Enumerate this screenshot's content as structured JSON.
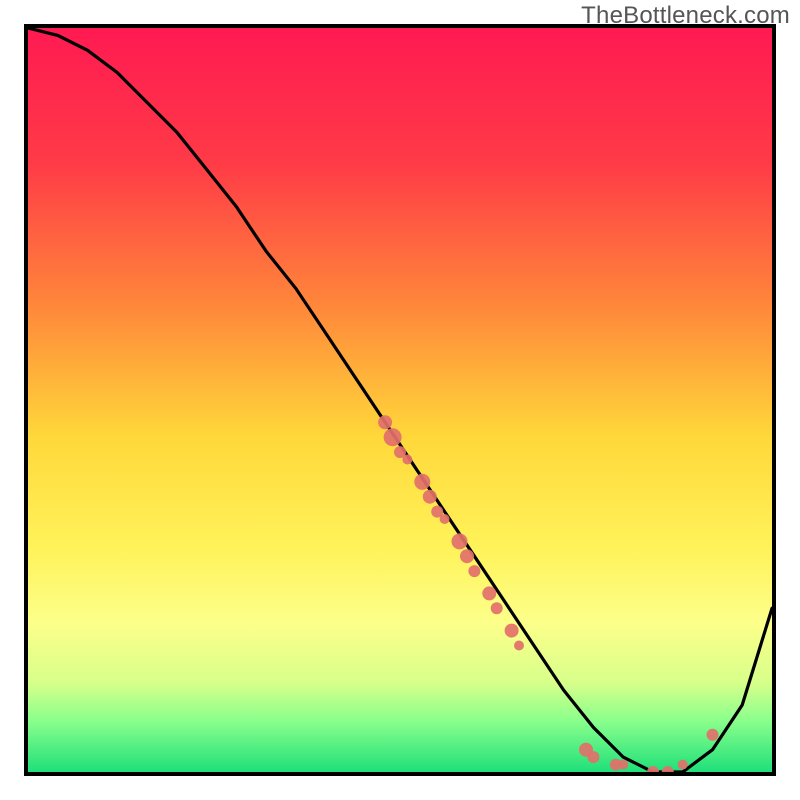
{
  "watermark": "TheBottleneck.com",
  "chart_data": {
    "type": "line",
    "title": "",
    "xlabel": "",
    "ylabel": "",
    "ylim": [
      0,
      100
    ],
    "xlim": [
      0,
      100
    ],
    "background_gradient": {
      "direction": "vertical",
      "stops": [
        {
          "pos": 0,
          "color": "#ff1a52"
        },
        {
          "pos": 18,
          "color": "#ff3a47"
        },
        {
          "pos": 38,
          "color": "#ff8a3a"
        },
        {
          "pos": 55,
          "color": "#ffd83a"
        },
        {
          "pos": 70,
          "color": "#fff35a"
        },
        {
          "pos": 80,
          "color": "#fcff8a"
        },
        {
          "pos": 88,
          "color": "#d7ff8a"
        },
        {
          "pos": 93,
          "color": "#8cff8c"
        },
        {
          "pos": 100,
          "color": "#1fe07a"
        }
      ]
    },
    "series": [
      {
        "name": "bottleneck-curve",
        "color": "#000000",
        "x": [
          0,
          4,
          8,
          12,
          16,
          20,
          24,
          28,
          32,
          36,
          40,
          44,
          48,
          52,
          56,
          60,
          64,
          68,
          72,
          76,
          80,
          84,
          88,
          92,
          96,
          100
        ],
        "y": [
          100,
          99,
          97,
          94,
          90,
          86,
          81,
          76,
          70,
          65,
          59,
          53,
          47,
          41,
          35,
          29,
          23,
          17,
          11,
          6,
          2,
          0,
          0,
          3,
          9,
          22
        ]
      }
    ],
    "scatter": {
      "name": "highlighted-points",
      "color": "#e2706a",
      "radius_range": [
        4,
        9
      ],
      "points": [
        {
          "x": 48,
          "y": 47,
          "r": 7
        },
        {
          "x": 49,
          "y": 45,
          "r": 9
        },
        {
          "x": 50,
          "y": 43,
          "r": 6
        },
        {
          "x": 51,
          "y": 42,
          "r": 5
        },
        {
          "x": 53,
          "y": 39,
          "r": 8
        },
        {
          "x": 54,
          "y": 37,
          "r": 7
        },
        {
          "x": 55,
          "y": 35,
          "r": 6
        },
        {
          "x": 56,
          "y": 34,
          "r": 5
        },
        {
          "x": 58,
          "y": 31,
          "r": 8
        },
        {
          "x": 59,
          "y": 29,
          "r": 7
        },
        {
          "x": 60,
          "y": 27,
          "r": 6
        },
        {
          "x": 62,
          "y": 24,
          "r": 7
        },
        {
          "x": 63,
          "y": 22,
          "r": 6
        },
        {
          "x": 65,
          "y": 19,
          "r": 7
        },
        {
          "x": 66,
          "y": 17,
          "r": 5
        },
        {
          "x": 75,
          "y": 3,
          "r": 7
        },
        {
          "x": 76,
          "y": 2,
          "r": 6
        },
        {
          "x": 79,
          "y": 1,
          "r": 6
        },
        {
          "x": 80,
          "y": 1,
          "r": 5
        },
        {
          "x": 84,
          "y": 0,
          "r": 6
        },
        {
          "x": 86,
          "y": 0,
          "r": 6
        },
        {
          "x": 88,
          "y": 1,
          "r": 5
        },
        {
          "x": 92,
          "y": 5,
          "r": 6
        }
      ]
    }
  }
}
